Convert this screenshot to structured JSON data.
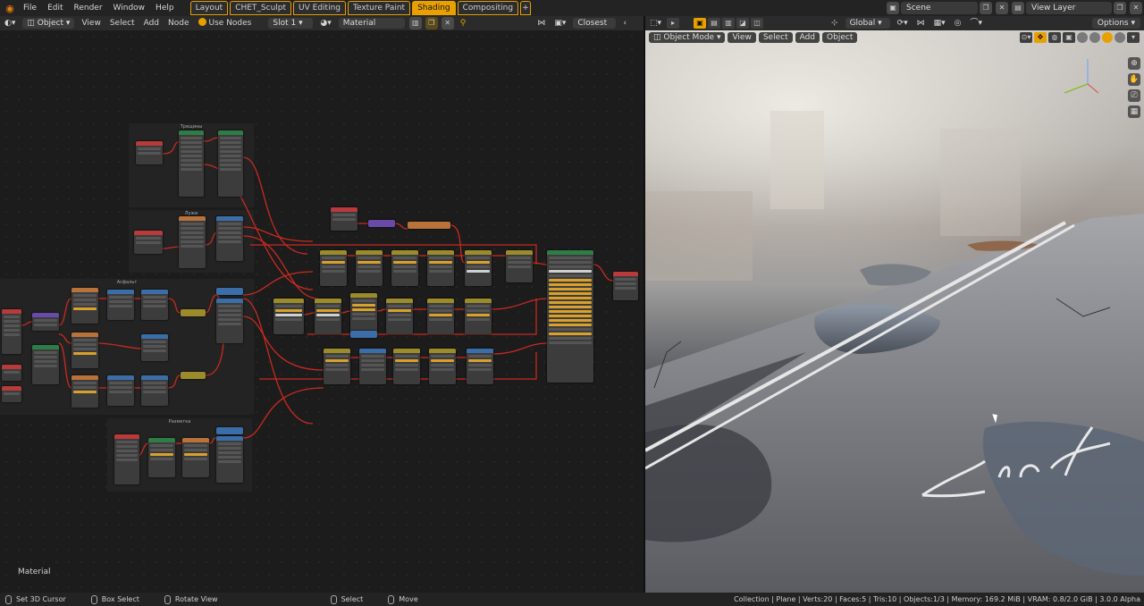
{
  "topbar": {
    "menus": [
      "File",
      "Edit",
      "Render",
      "Window",
      "Help"
    ],
    "workspaces": [
      {
        "label": "Layout",
        "active": false
      },
      {
        "label": "CHET_Sculpt",
        "active": false
      },
      {
        "label": "UV Editing",
        "active": false
      },
      {
        "label": "Texture Paint",
        "active": false
      },
      {
        "label": "Shading",
        "active": true
      },
      {
        "label": "Compositing",
        "active": false
      }
    ],
    "add_tab": "+",
    "scene": "Scene",
    "view_layer": "View Layer"
  },
  "node_header": {
    "object_mode": "Object",
    "menus": [
      "View",
      "Select",
      "Add",
      "Node"
    ],
    "use_nodes": "Use Nodes",
    "slot": "Slot 1",
    "material": "Material",
    "snap": "Closest"
  },
  "node_editor": {
    "bottom_label": "Material",
    "frames": [
      "Трещины",
      "Лужи",
      "Асфальт",
      "Разметка"
    ]
  },
  "viewport_header": {
    "orientation": "Global",
    "options": "Options"
  },
  "viewport": {
    "mode": "Object Mode",
    "menus": [
      "View",
      "Select",
      "Add",
      "Object"
    ]
  },
  "statusbar": {
    "hints": [
      "Set 3D Cursor",
      "Box Select",
      "Rotate View",
      "Select",
      "Move"
    ],
    "info": "Collection | Plane | Verts:20 | Faces:5 | Tris:10 | Objects:1/3 | Memory: 169.2 MiB | VRAM: 0.8/2.0 GiB | 3.0.0 Alpha"
  },
  "colors": {
    "accent": "#e8a000",
    "node_header_red": "#b83a3a",
    "node_header_green": "#2e7d46",
    "node_header_blue": "#3b6ea8",
    "node_header_yellow": "#9c8b2a",
    "wire": "#c82a20"
  }
}
